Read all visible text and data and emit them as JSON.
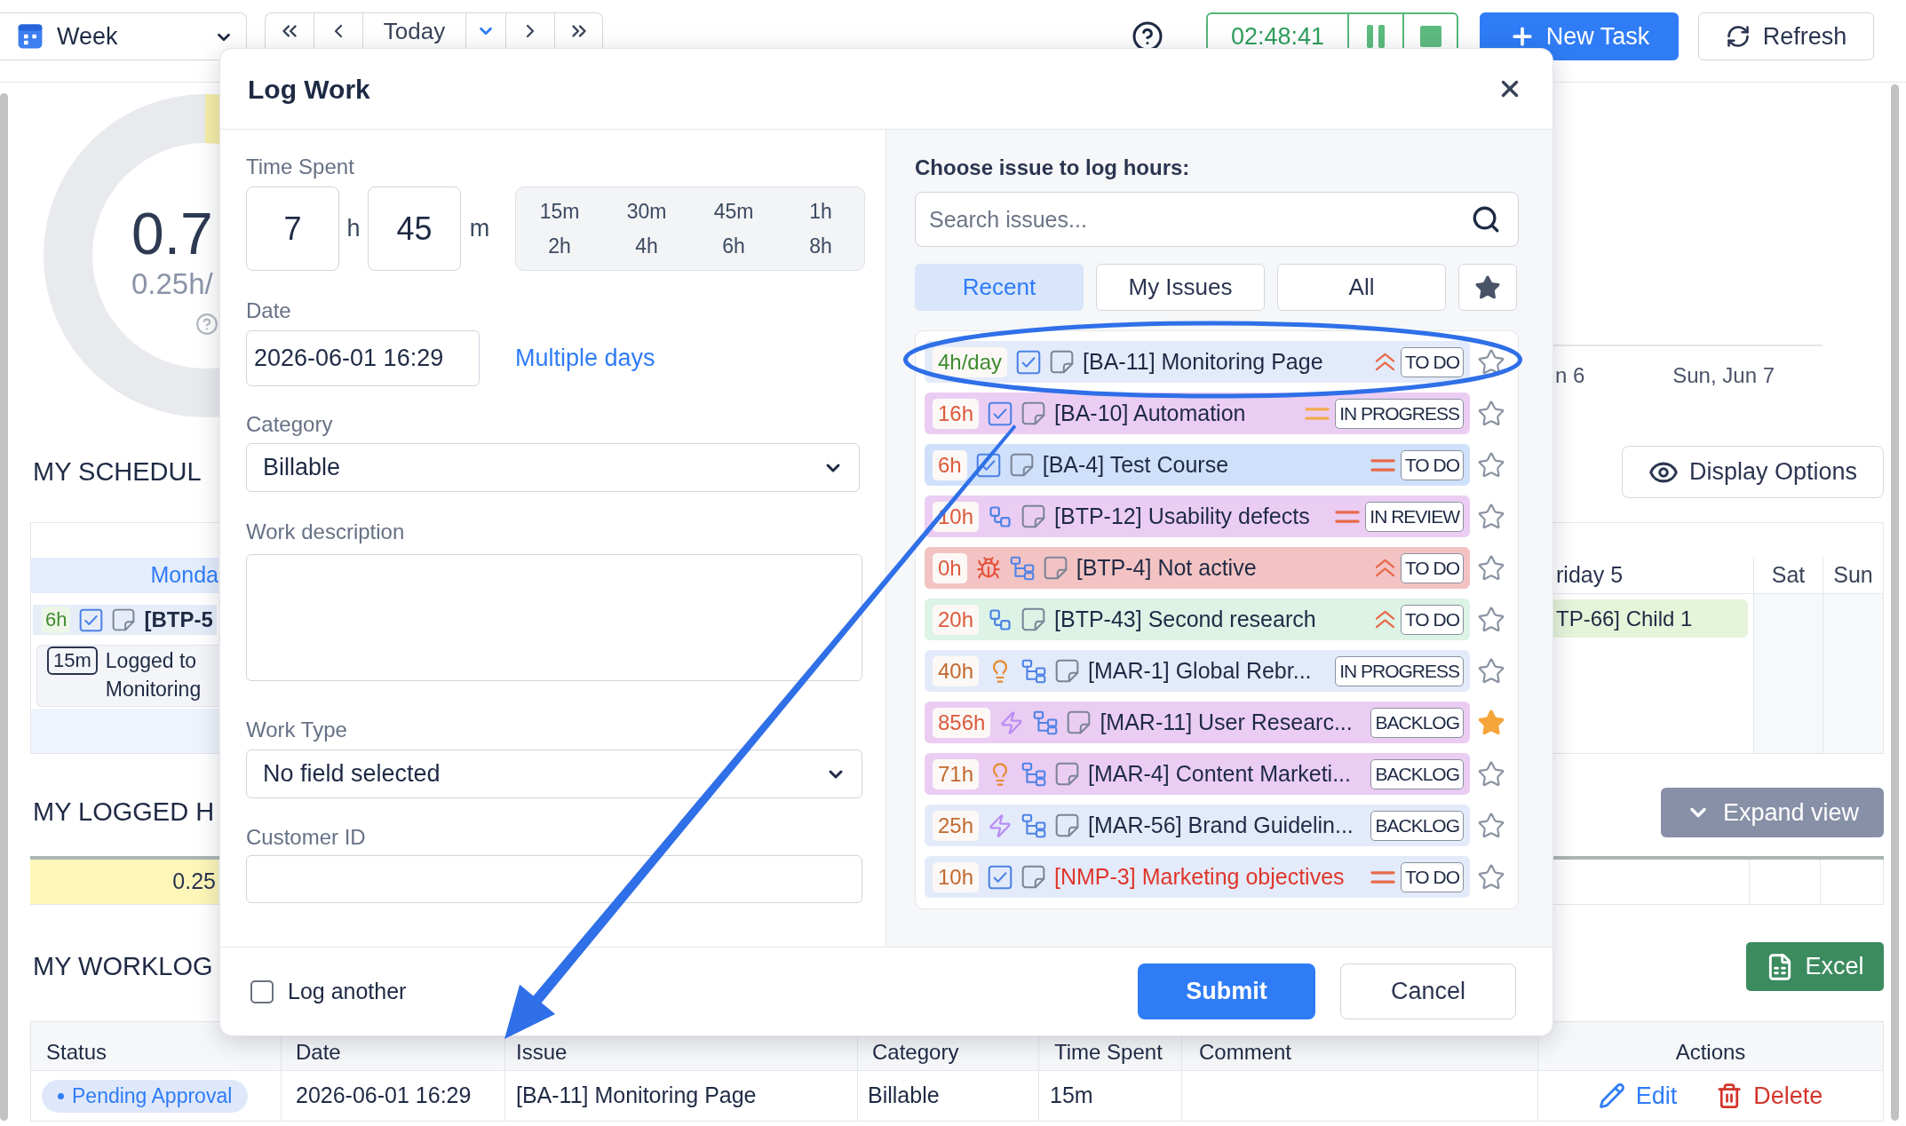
{
  "toolbar": {
    "view_select": {
      "value": "Week"
    },
    "today_button": "Today",
    "timer": {
      "time": "02:48:41"
    },
    "new_task_button": "New Task",
    "refresh_button": "Refresh"
  },
  "summary": {
    "value": "0.7",
    "rate": "0.25h/"
  },
  "chart": {
    "x_labels": [
      "n 6",
      "Sun, Jun 7"
    ]
  },
  "schedule": {
    "title": "MY SCHEDUL",
    "display_options_button": "Display Options",
    "days": [
      {
        "label": "Monda",
        "today": true,
        "weekend": false,
        "entries": [
          {
            "kind": "issue",
            "hours": "6h",
            "icons": [
              {
                "kind": "check"
              }
            ],
            "title": "[BTP-5"
          },
          {
            "kind": "log",
            "duration": "15m",
            "text": "Logged to Monitoring"
          }
        ]
      },
      {
        "label": "riday 5",
        "today": false,
        "weekend": false,
        "entries": [
          {
            "kind": "bar",
            "title": "TP-66] Child 1",
            "color": "#e6f4da"
          }
        ]
      },
      {
        "label": "Sat",
        "today": false,
        "weekend": true
      },
      {
        "label": "Sun",
        "today": false,
        "weekend": true
      }
    ]
  },
  "logged_hours": {
    "title": "MY LOGGED H",
    "expand_button": "Expand view",
    "total": "0.25"
  },
  "worklog": {
    "title": "MY WORKLOG",
    "excel_button": "Excel",
    "columns": [
      "Status",
      "Date",
      "Issue",
      "Category",
      "Time Spent",
      "Comment",
      "Actions"
    ],
    "rows": [
      {
        "status": "Pending Approval",
        "date": "2026-06-01 16:29",
        "issue": "[BA-11] Monitoring Page",
        "category": "Billable",
        "time_spent": "15m",
        "edit": "Edit",
        "delete": "Delete"
      }
    ]
  },
  "dialog": {
    "title": "Log Work",
    "time_spent": {
      "label": "Time Spent",
      "hours": "7",
      "hours_unit": "h",
      "minutes": "45",
      "minutes_unit": "m",
      "presets": [
        "15m",
        "30m",
        "45m",
        "1h",
        "2h",
        "4h",
        "6h",
        "8h"
      ]
    },
    "date": {
      "label": "Date",
      "value": "2026-06-01 16:29",
      "link": "Multiple days"
    },
    "category": {
      "label": "Category",
      "value": "Billable"
    },
    "work_description": {
      "label": "Work description"
    },
    "work_type": {
      "label": "Work Type",
      "value": "No field selected"
    },
    "customer_id": {
      "label": "Customer ID"
    },
    "issue_picker": {
      "label": "Choose issue to log hours:",
      "search": {
        "placeholder": "Search issues..."
      },
      "tabs": [
        {
          "label": "Recent",
          "selected": true
        },
        {
          "label": "My Issues",
          "selected": false
        },
        {
          "label": "All",
          "selected": false
        }
      ],
      "issues": [
        {
          "hours": {
            "text": "4h/day",
            "color": "#3d8b2f"
          },
          "icons": [
            {
              "kind": "check"
            }
          ],
          "title": {
            "text": "[BA-11] Monitoring Page",
            "color": "#1e2a44"
          },
          "priority": {
            "kind": "chevrons",
            "color": "#e8694a"
          },
          "status": "TO DO",
          "color": "#e3ebfb",
          "starred": false,
          "highlighted": true
        },
        {
          "hours": {
            "text": "16h",
            "color": "#dc5a3c"
          },
          "icons": [
            {
              "kind": "check"
            }
          ],
          "title": {
            "text": "[BA-10] Automation",
            "color": "#1e2a44"
          },
          "priority": {
            "kind": "lines",
            "color": "#f2ac4e"
          },
          "status": "IN PROGRESS",
          "color": "#ebcdf3",
          "starred": false,
          "highlighted": false
        },
        {
          "hours": {
            "text": "6h",
            "color": "#dc5a3c"
          },
          "icons": [
            {
              "kind": "check"
            }
          ],
          "title": {
            "text": "[BA-4] Test Course",
            "color": "#1e2a44"
          },
          "priority": {
            "kind": "lines",
            "color": "#e8694a"
          },
          "status": "TO DO",
          "color": "#cfe0fb",
          "starred": false,
          "highlighted": false
        },
        {
          "hours": {
            "text": "10h",
            "color": "#dc5a3c"
          },
          "icons": [
            {
              "kind": "link"
            }
          ],
          "title": {
            "text": "[BTP-12] Usability defects",
            "color": "#1e2a44"
          },
          "priority": {
            "kind": "lines",
            "color": "#e8694a"
          },
          "status": "IN REVIEW",
          "color": "#ebcdf3",
          "starred": false,
          "highlighted": false
        },
        {
          "hours": {
            "text": "0h",
            "color": "#dc5a3c"
          },
          "icons": [
            {
              "kind": "bug"
            },
            {
              "kind": "tree"
            }
          ],
          "title": {
            "text": "[BTP-4] Not active",
            "color": "#1e2a44"
          },
          "priority": {
            "kind": "chevrons",
            "color": "#e8694a"
          },
          "status": "TO DO",
          "color": "#f3c3c3",
          "starred": false,
          "highlighted": false
        },
        {
          "hours": {
            "text": "20h",
            "color": "#dc5a3c"
          },
          "icons": [
            {
              "kind": "link"
            }
          ],
          "title": {
            "text": "[BTP-43] Second research",
            "color": "#1e2a44"
          },
          "priority": {
            "kind": "chevrons",
            "color": "#e8694a"
          },
          "status": "TO DO",
          "color": "#dcf3e6",
          "starred": false,
          "highlighted": false
        },
        {
          "hours": {
            "text": "40h",
            "color": "#c2692e"
          },
          "icons": [
            {
              "kind": "bulb"
            },
            {
              "kind": "tree"
            }
          ],
          "title": {
            "text": "[MAR-1] Global Rebr...",
            "color": "#1e2a44"
          },
          "status": "IN PROGRESS",
          "color": "#e3ebfa",
          "starred": false,
          "highlighted": false
        },
        {
          "hours": {
            "text": "856h",
            "color": "#dc5a3c"
          },
          "icons": [
            {
              "kind": "bolt"
            },
            {
              "kind": "tree"
            }
          ],
          "title": {
            "text": "[MAR-11] User Researc...",
            "color": "#1e2a44"
          },
          "status": "BACKLOG",
          "color": "#ebcdf3",
          "starred": true,
          "highlighted": false
        },
        {
          "hours": {
            "text": "71h",
            "color": "#c2692e"
          },
          "icons": [
            {
              "kind": "bulb"
            },
            {
              "kind": "tree"
            }
          ],
          "title": {
            "text": "[MAR-4] Content Marketi...",
            "color": "#1e2a44"
          },
          "status": "BACKLOG",
          "color": "#ebcdf3",
          "starred": false,
          "highlighted": false
        },
        {
          "hours": {
            "text": "25h",
            "color": "#c2692e"
          },
          "icons": [
            {
              "kind": "bolt"
            },
            {
              "kind": "tree"
            }
          ],
          "title": {
            "text": "[MAR-56] Brand Guidelin...",
            "color": "#1e2a44"
          },
          "status": "BACKLOG",
          "color": "#e3ebfa",
          "starred": false,
          "highlighted": false
        },
        {
          "hours": {
            "text": "10h",
            "color": "#c2692e"
          },
          "icons": [
            {
              "kind": "check"
            }
          ],
          "title": {
            "text": "[NMP-3] Marketing objectives",
            "color": "#e0362b"
          },
          "priority": {
            "kind": "lines",
            "color": "#e8694a"
          },
          "status": "TO DO",
          "color": "#e3ebfa",
          "starred": false,
          "highlighted": false
        }
      ]
    },
    "log_another": {
      "label": "Log another",
      "checked": false
    },
    "submit_button": "Submit",
    "cancel_button": "Cancel"
  }
}
